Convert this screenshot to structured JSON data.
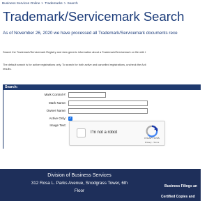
{
  "breadcrumb": {
    "items": [
      "Business Services Online",
      "Trademarks",
      "Search"
    ],
    "separator": ">"
  },
  "page_title": "Trademark/Servicemark Search",
  "as_of_text": "As of November 26, 2020 we have processed all Trademark/Servicemark documents rece",
  "intro_text": "Search the Trademark/Servicemark Registry and view generic information about a Trademark/Servicemark on file with t",
  "note_text": {
    "line1": "The default search is for active registrations only. To search for both active and cancelled registrations, uncheck the Acti",
    "line2": "results."
  },
  "search_section": {
    "header": "Search:",
    "fields": {
      "mark_control": {
        "label": "Mark Control #:",
        "value": ""
      },
      "mark_name": {
        "label": "Mark Name:",
        "value": ""
      },
      "owner_name": {
        "label": "Owner Name:",
        "value": ""
      },
      "active_only": {
        "label": "Active Only:",
        "checked": true,
        "check_glyph": "✓"
      },
      "image_text": {
        "label": "Image Text:"
      }
    },
    "captcha": {
      "text": "I'm not a robot",
      "brand": "reCAPTCHA",
      "links": "Privacy - Terms",
      "icon": "recaptcha-logo-icon"
    }
  },
  "footer": {
    "title": "Division of Business Services",
    "address_line1": "312 Rosa L. Parks Avenue, Snodgrass Tower, 6th",
    "address_line2": "Floor",
    "links": [
      "Business Filings an",
      "Certified Copies and"
    ]
  },
  "colors": {
    "navy": "#1f3a6e",
    "title_blue": "#1c3c7a",
    "footer_bg": "#1e2f5a",
    "checkbox_blue": "#1a73e8"
  }
}
